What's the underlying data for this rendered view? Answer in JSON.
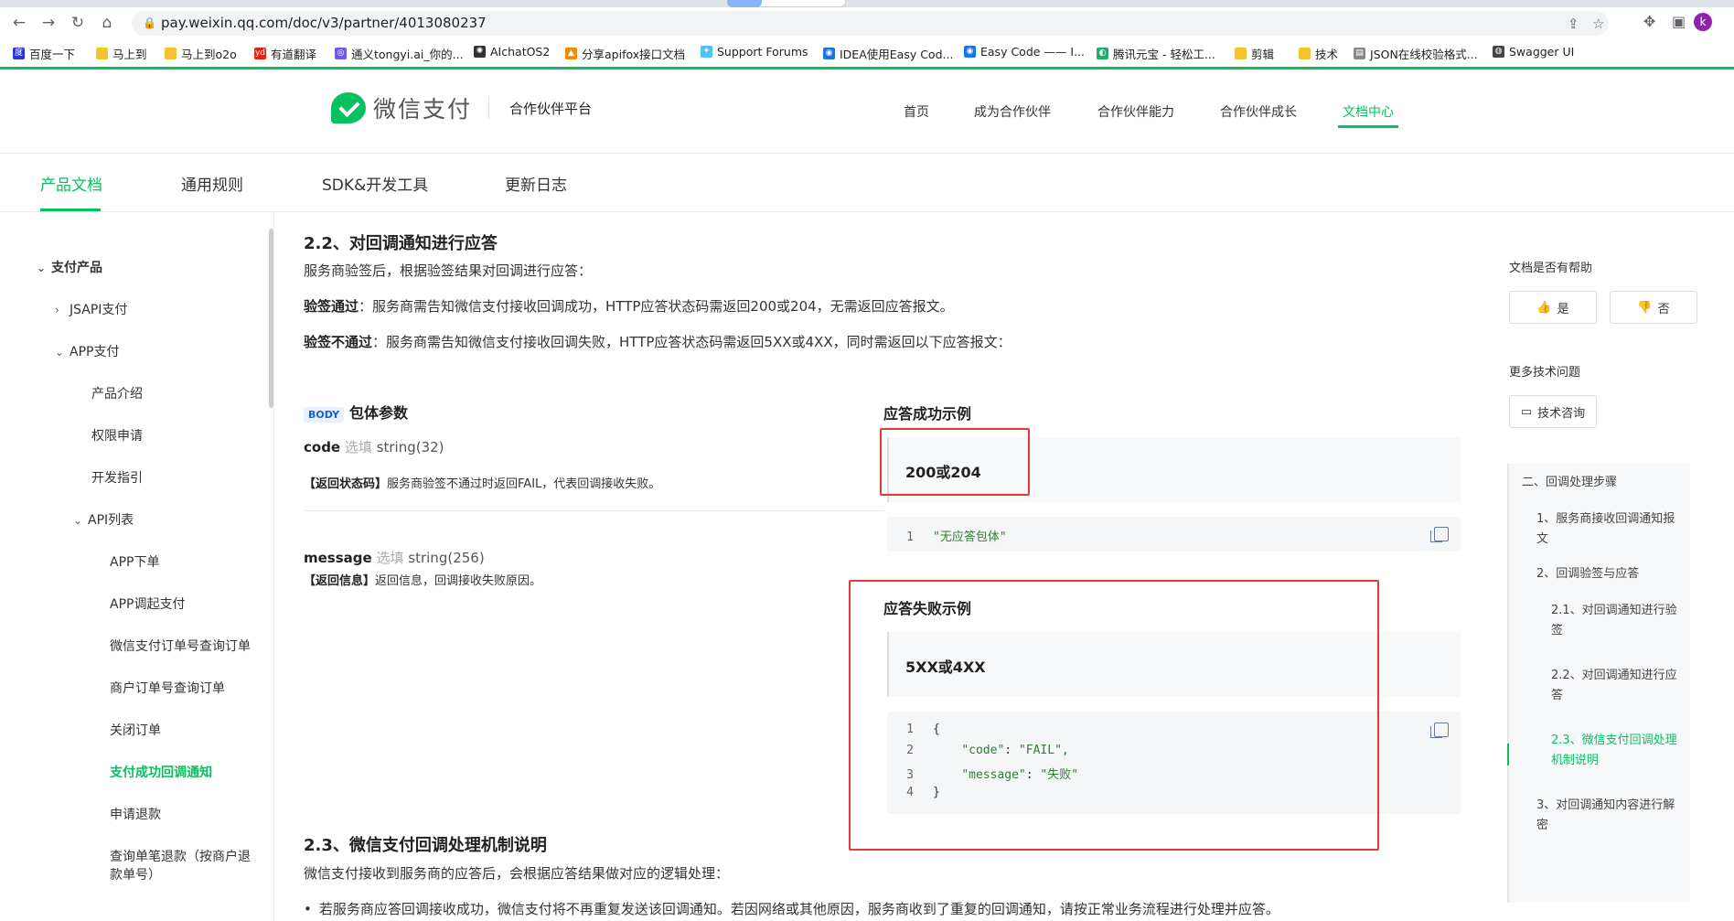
{
  "browser": {
    "url": "pay.weixin.qq.com/doc/v3/partner/4013080237",
    "bookmarks": [
      "百度一下",
      "马上到",
      "马上到o2o",
      "有道翻译",
      "通义tongyi.ai_你的...",
      "AIchatOS2",
      "分享apifox接口文档",
      "Support Forums",
      "IDEA使用Easy Cod...",
      "Easy Code —— I...",
      "腾讯元宝 - 轻松工...",
      "剪辑",
      "技术",
      "JSON在线校验格式...",
      "Swagger UI"
    ],
    "avatar_letter": "k"
  },
  "header": {
    "brand": "微信支付",
    "platform": "合作伙伴平台",
    "nav": [
      "首页",
      "成为合作伙伴",
      "合作伙伴能力",
      "合作伙伴成长",
      "文档中心"
    ]
  },
  "subnav": [
    "产品文档",
    "通用规则",
    "SDK&开发工具",
    "更新日志"
  ],
  "sidebar": {
    "items": [
      "支付产品",
      "JSAPI支付",
      "APP支付",
      "产品介绍",
      "权限申请",
      "开发指引",
      "API列表",
      "APP下单",
      "APP调起支付",
      "微信支付订单号查询订单",
      "商户订单号查询订单",
      "关闭订单",
      "支付成功回调通知",
      "申请退款",
      "查询单笔退款（按商户退",
      "款单号）"
    ]
  },
  "main": {
    "h_2_2": "2.2、对回调通知进行应答",
    "intro": "服务商验签后，根据验签结果对回调进行应答：",
    "pass_label": "验签通过",
    "pass_text": "：服务商需告知微信支付接收回调成功，HTTP应答状态码需返回200或204，无需返回应答报文。",
    "fail_label": "验签不通过",
    "fail_text": "：服务商需告知微信支付接收回调失败，HTTP应答状态码需返回5XX或4XX，同时需返回以下应答报文：",
    "body_tag": "BODY",
    "body_title": "包体参数",
    "params": [
      {
        "name": "code",
        "opt": "选填",
        "type": "string(32)",
        "desc_label": "【返回状态码】",
        "desc": "服务商验签不通过时返回FAIL，代表回调接收失败。"
      },
      {
        "name": "message",
        "opt": "选填",
        "type": "string(256)",
        "desc_label": "【返回信息】",
        "desc": "返回信息，回调接收失败原因。"
      }
    ],
    "success_title": "应答成功示例",
    "success_status": "200或204",
    "success_code_ln": "1",
    "success_code": "\"无应答包体\"",
    "fail_title": "应答失败示例",
    "fail_status": "5XX或4XX",
    "fail_code": [
      {
        "ln": "1",
        "text": "{"
      },
      {
        "ln": "2",
        "key": "\"code\"",
        "val": "\"FAIL\","
      },
      {
        "ln": "3",
        "key": "\"message\"",
        "val": "\"失败\""
      },
      {
        "ln": "4",
        "text": "}"
      }
    ],
    "h_2_3": "2.3、微信支付回调处理机制说明",
    "p_2_3": "微信支付接收到服务商的应答后，会根据应答结果做对应的逻辑处理：",
    "bullet_1": "若服务商应答回调接收成功，微信支付将不再重复发送该回调通知。若因网络或其他原因，服务商收到了重复的回调通知，请按正常业务流程进行处理并应答。"
  },
  "right": {
    "helpful_label": "文档是否有帮助",
    "yes": "是",
    "no": "否",
    "more_label": "更多技术问题",
    "consult": "技术咨询",
    "toc": [
      "二、回调处理步骤",
      "1、服务商接收回调通知报文",
      "2、回调验签与应答",
      "2.1、对回调通知进行验签",
      "2.2、对回调通知进行应答",
      "2.3、微信支付回调处理机制说明",
      "3、对回调通知内容进行解密"
    ]
  },
  "colors": {
    "accent": "#07c160",
    "highlight": "#e53935"
  }
}
